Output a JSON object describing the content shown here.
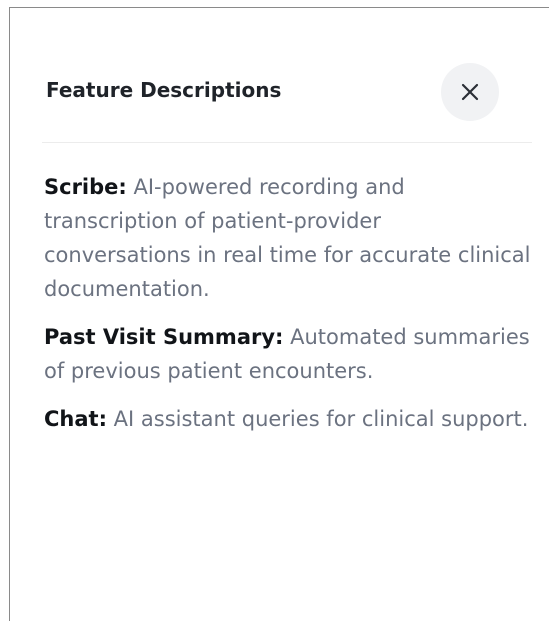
{
  "panel": {
    "title": "Feature Descriptions",
    "close_icon": "close-icon"
  },
  "features": [
    {
      "name": "Scribe:",
      "description": " AI-powered recording and transcription of patient-provider conversations in real time for accurate clinical documentation."
    },
    {
      "name": "Past Visit Summary:",
      "description": " Automated summaries of previous patient encounters."
    },
    {
      "name": "Chat:",
      "description": " AI assistant queries for clinical support."
    }
  ],
  "colors": {
    "title": "#1f2329",
    "feature_name": "#111418",
    "description": "#6b7280",
    "close_button_bg": "#f1f2f4"
  }
}
